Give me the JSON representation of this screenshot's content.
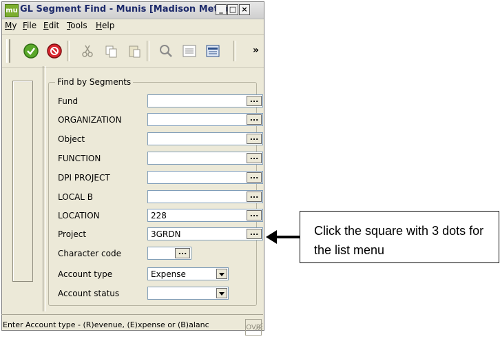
{
  "window": {
    "app_icon": "mu",
    "title": "GL Segment Find - Munis [Madison Metro..."
  },
  "window_controls": {
    "minimize": "_",
    "maximize": "□",
    "close": "×"
  },
  "menu": [
    {
      "label": "My",
      "underline": "M",
      "rest": "y"
    },
    {
      "label": "File",
      "underline": "F",
      "rest": "ile"
    },
    {
      "label": "Edit",
      "underline": "E",
      "rest": "dit"
    },
    {
      "label": "Tools",
      "underline": "T",
      "rest": "ools"
    },
    {
      "label": "Help",
      "underline": "H",
      "rest": "elp"
    }
  ],
  "toolbar": {
    "buttons": [
      "accept-icon",
      "cancel-icon",
      "cut-icon",
      "copy-icon",
      "paste-icon",
      "search-icon",
      "browse-icon",
      "list-icon"
    ],
    "overflow": "»"
  },
  "group": {
    "title": "Find by Segments"
  },
  "fields": [
    {
      "label": "Fund",
      "value": ""
    },
    {
      "label": "ORGANIZATION",
      "value": ""
    },
    {
      "label": "Object",
      "value": ""
    },
    {
      "label": "FUNCTION",
      "value": ""
    },
    {
      "label": "DPI PROJECT",
      "value": ""
    },
    {
      "label": "LOCAL B",
      "value": ""
    },
    {
      "label": "LOCATION",
      "value": "228"
    },
    {
      "label": "Project",
      "value": "3GRDN"
    }
  ],
  "character_code": {
    "label": "Character code",
    "value": ""
  },
  "account_type": {
    "label": "Account type",
    "value": "Expense"
  },
  "account_status": {
    "label": "Account status",
    "value": ""
  },
  "dots_label": "...",
  "status": {
    "text": "Enter Account type - (R)evenue, (E)xpense or (B)alanc",
    "ovr": "OVR"
  },
  "callout": {
    "text": "Click the square with 3 dots for the list menu"
  }
}
